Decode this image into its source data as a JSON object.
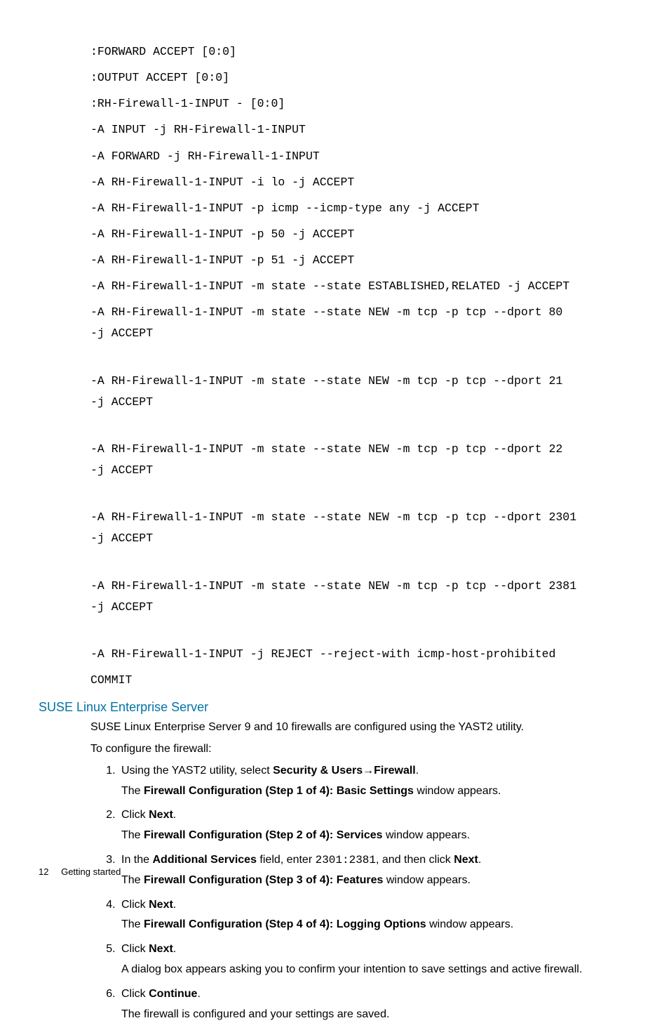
{
  "code": {
    "l1": ":FORWARD ACCEPT [0:0]",
    "l2": ":OUTPUT ACCEPT [0:0]",
    "l3": ":RH-Firewall-1-INPUT - [0:0]",
    "l4": "-A INPUT -j RH-Firewall-1-INPUT",
    "l5": "-A FORWARD -j RH-Firewall-1-INPUT",
    "l6": "-A RH-Firewall-1-INPUT -i lo -j ACCEPT",
    "l7": "-A RH-Firewall-1-INPUT -p icmp --icmp-type any -j ACCEPT",
    "l8": "-A RH-Firewall-1-INPUT -p 50 -j ACCEPT",
    "l9": "-A RH-Firewall-1-INPUT -p 51 -j ACCEPT",
    "l10": "-A RH-Firewall-1-INPUT -m state --state ESTABLISHED,RELATED -j ACCEPT",
    "l11": "-A RH-Firewall-1-INPUT -m state --state NEW -m tcp -p tcp --dport 80",
    "l11b": "-j ACCEPT",
    "l12": "-A RH-Firewall-1-INPUT -m state --state NEW -m tcp -p tcp --dport 21",
    "l12b": "-j ACCEPT",
    "l13": "-A RH-Firewall-1-INPUT -m state --state NEW -m tcp -p tcp --dport 22",
    "l13b": "-j ACCEPT",
    "l14": "-A RH-Firewall-1-INPUT -m state --state NEW -m tcp -p tcp --dport 2301",
    "l14b": "-j ACCEPT",
    "l15": "-A RH-Firewall-1-INPUT -m state --state NEW -m tcp -p tcp --dport 2381",
    "l15b": "-j ACCEPT",
    "l16": "-A RH-Firewall-1-INPUT -j REJECT --reject-with icmp-host-prohibited",
    "l17": "COMMIT"
  },
  "heading": "SUSE Linux Enterprise Server",
  "intro1": "SUSE Linux Enterprise Server 9 and 10 firewalls are configured using the YAST2 utility.",
  "intro2": "To configure the firewall:",
  "steps": {
    "s1a": "Using the YAST2 utility, select ",
    "s1b": "Security & Users",
    "s1arrow": "→",
    "s1c": "Firewall",
    "s1d": ".",
    "s1sub_a": "The ",
    "s1sub_b": "Firewall Configuration (Step 1 of 4): Basic Settings",
    "s1sub_c": " window appears.",
    "s2a": "Click ",
    "s2b": "Next",
    "s2c": ".",
    "s2sub_a": "The ",
    "s2sub_b": "Firewall Configuration (Step 2 of 4): Services",
    "s2sub_c": " window appears.",
    "s3a": "In the ",
    "s3b": "Additional Services",
    "s3c": " field, enter ",
    "s3d": "2301:2381",
    "s3e": ", and then click ",
    "s3f": "Next",
    "s3g": ".",
    "s3sub_a": "The ",
    "s3sub_b": "Firewall Configuration (Step 3 of 4): Features",
    "s3sub_c": " window appears.",
    "s4a": "Click ",
    "s4b": "Next",
    "s4c": ".",
    "s4sub_a": "The ",
    "s4sub_b": "Firewall Configuration (Step 4 of 4): Logging Options",
    "s4sub_c": " window appears.",
    "s5a": "Click ",
    "s5b": "Next",
    "s5c": ".",
    "s5sub": "A dialog box appears asking you to confirm your intention to save settings and active firewall.",
    "s6a": "Click ",
    "s6b": "Continue",
    "s6c": ".",
    "s6sub": "The firewall is configured and your settings are saved."
  },
  "footer": {
    "page": "12",
    "section": "Getting started"
  }
}
